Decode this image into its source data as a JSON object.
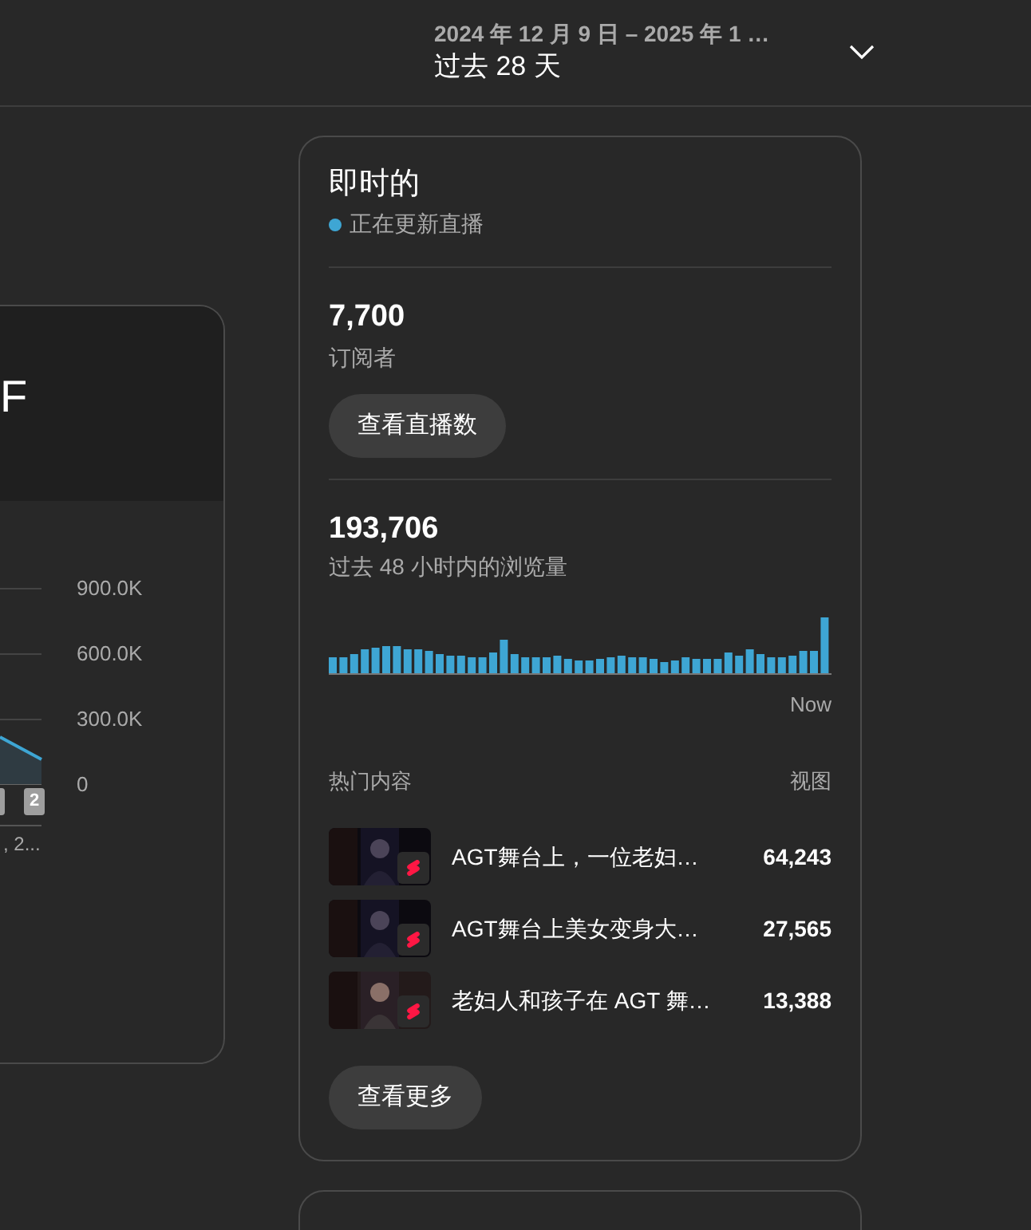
{
  "header": {
    "date_range": "2024 年 12 月 9 日 – 2025 年 1 …",
    "period": "过去 28 天"
  },
  "left_card": {
    "title_fragment": "F",
    "axis_labels": [
      "900.0K",
      "600.0K",
      "300.0K",
      "0"
    ],
    "marker": "2",
    "date_fragment": ", 2..."
  },
  "realtime": {
    "title": "即时的",
    "status": "正在更新直播",
    "subscribers": {
      "value": "7,700",
      "label": "订阅者",
      "button": "查看直播数"
    },
    "views": {
      "value": "193,706",
      "label": "过去 48 小时内的浏览量",
      "axis_end": "Now"
    },
    "top_content": {
      "column_1": "热门内容",
      "column_2": "视图",
      "rows": [
        {
          "title": "AGT舞台上，一位老妇…",
          "views": "64,243"
        },
        {
          "title": "AGT舞台上美女变身大…",
          "views": "27,565"
        },
        {
          "title": "老妇人和孩子在 AGT 舞…",
          "views": "13,388"
        }
      ]
    },
    "more_button": "查看更多"
  }
}
